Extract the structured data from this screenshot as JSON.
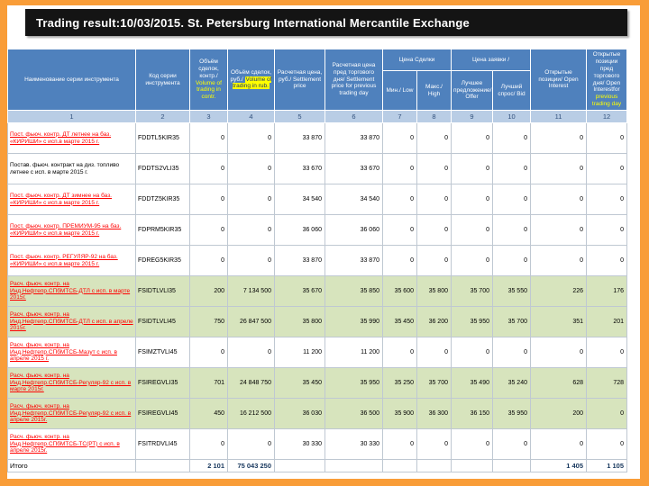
{
  "title": "Trading result:10/03/2015. St. Petersburg International Mercantile Exchange",
  "colors": {
    "frame_orange": "#F99D38",
    "header_blue": "#4F81BD",
    "light_blue": "#B9CDE5",
    "row_green": "#D7E4BD",
    "link_red": "#FF0000",
    "highlight_yellow": "#FFFF00"
  },
  "table": {
    "headers": {
      "name": "Наименование серии инструмента",
      "code": "Код серии инструмента",
      "vol_contr_ru": "Объём сделок, контр./ ",
      "vol_contr_en": "Volume of trading in contr.",
      "vol_rub_ru": "Объём сделок, руб./ ",
      "vol_rub_en": "Volume of trading in rub.",
      "settlement": "Расчетная цена, руб./ Settlement price",
      "settlement_prev": "Расчетная цена пред торгового дня/ Settlement price for previous trading day",
      "trade_price_group": "Цена Сделки",
      "order_price_group": "Цена заявки /",
      "min_low": "Мин./ Low",
      "max_high": "Макс./ High",
      "offer": "Лучшее предложение/ Offer",
      "bid": "Лучший спрос/ Bid",
      "open_interest": "Открытые позиции/ Open Interest",
      "open_interest_prev_white": "Открытые позиции пред торгового дня/ Open Interestfor ",
      "open_interest_prev_yellow": "previous trading day"
    },
    "col_numbers": [
      "1",
      "2",
      "3",
      "4",
      "5",
      "6",
      "7",
      "8",
      "9",
      "10",
      "11",
      "12"
    ],
    "rows": [
      {
        "name": "Пост. фьюч. контр. ДТ летнее на баз. «КИРИШИ» с исп.в марте 2015 г.",
        "code": "FDDTL5KIR35",
        "link": true,
        "highlight": false,
        "values": [
          "0",
          "0",
          "33 870",
          "33 870",
          "0",
          "0",
          "0",
          "0",
          "0",
          "0"
        ]
      },
      {
        "name": "Постав. фьюч. контракт на диз. топливо летнее с исп. в марте 2015 г.",
        "code": "FDDTS2VLI35",
        "link": false,
        "highlight": false,
        "values": [
          "0",
          "0",
          "33 670",
          "33 670",
          "0",
          "0",
          "0",
          "0",
          "0",
          "0"
        ]
      },
      {
        "name": "Пост. фьюч. контр. ДТ зимнее на баз. «КИРИШИ» с исп.в марте 2015 г.",
        "code": "FDDTZ5KIR35",
        "link": true,
        "highlight": false,
        "values": [
          "0",
          "0",
          "34 540",
          "34 540",
          "0",
          "0",
          "0",
          "0",
          "0",
          "0"
        ]
      },
      {
        "name": "Пост. фьюч. контр. ПРЕМИУМ-95 на баз. «КИРИШИ» с исп.в марте 2015 г.",
        "code": "FDPRM5KIR35",
        "link": true,
        "highlight": false,
        "values": [
          "0",
          "0",
          "36 060",
          "36 060",
          "0",
          "0",
          "0",
          "0",
          "0",
          "0"
        ]
      },
      {
        "name": "Пост. фьюч. контр. РЕГУЛЯР-92 на баз. «КИРИШИ» с исп.в марте 2015 г.",
        "code": "FDREG5KIR35",
        "link": true,
        "highlight": false,
        "values": [
          "0",
          "0",
          "33 870",
          "33 870",
          "0",
          "0",
          "0",
          "0",
          "0",
          "0"
        ]
      },
      {
        "name": "Расч. фьюч. контр. на Инд.Нефтепр.СПбМТСБ-ДТЛ с исп. в марте 2015г.",
        "code": "FSIDTLVLI35",
        "link": true,
        "highlight": true,
        "values": [
          "200",
          "7 134 500",
          "35 670",
          "35 850",
          "35 600",
          "35 800",
          "35 700",
          "35 550",
          "226",
          "176"
        ]
      },
      {
        "name": "Расч. фьюч. контр. на Инд.Нефтепр.СПбМТСБ-ДТЛ с исп. в апреле 2015г.",
        "code": "FSIDTLVLI45",
        "link": true,
        "highlight": true,
        "values": [
          "750",
          "26 847 500",
          "35 800",
          "35 990",
          "35 450",
          "36 200",
          "35 950",
          "35 700",
          "351",
          "201"
        ]
      },
      {
        "name": "Расч. фьюч. контр. на Инд.Нефтепр.СПбМТСБ-Мазут с исп. в апреле 2015 г.",
        "code": "FSIMZTVLI45",
        "link": true,
        "highlight": false,
        "values": [
          "0",
          "0",
          "11 200",
          "11 200",
          "0",
          "0",
          "0",
          "0",
          "0",
          "0"
        ]
      },
      {
        "name": "Расч. фьюч. контр. на Инд.Нефтепр.СПбМТСБ-Регуляр-92 с исп. в марте 2015г.",
        "code": "FSIREGVLI35",
        "link": true,
        "highlight": true,
        "values": [
          "701",
          "24 848 750",
          "35 450",
          "35 950",
          "35 250",
          "35 700",
          "35 490",
          "35 240",
          "628",
          "728"
        ]
      },
      {
        "name": "Расч. фьюч. контр. на Инд.Нефтепр.СПбМТСБ-Регуляр-92 с исп. в апреле 2015г.",
        "code": "FSIREGVLI45",
        "link": true,
        "highlight": true,
        "values": [
          "450",
          "16 212 500",
          "36 030",
          "36 500",
          "35 900",
          "36 300",
          "36 150",
          "35 950",
          "200",
          "0"
        ]
      },
      {
        "name": "Расч. фьюч. контр. на Инд.Нефтепр.СПбМТСБ-ТС(РТ) с исп. в апреле 2015г.",
        "code": "FSITRDVLI45",
        "link": true,
        "highlight": false,
        "values": [
          "0",
          "0",
          "30 330",
          "30 330",
          "0",
          "0",
          "0",
          "0",
          "0",
          "0"
        ]
      }
    ],
    "total": {
      "label": "Итого",
      "values": [
        "2 101",
        "75 043 250",
        "",
        "",
        "",
        "",
        "",
        "",
        "1 405",
        "1 105"
      ]
    }
  }
}
